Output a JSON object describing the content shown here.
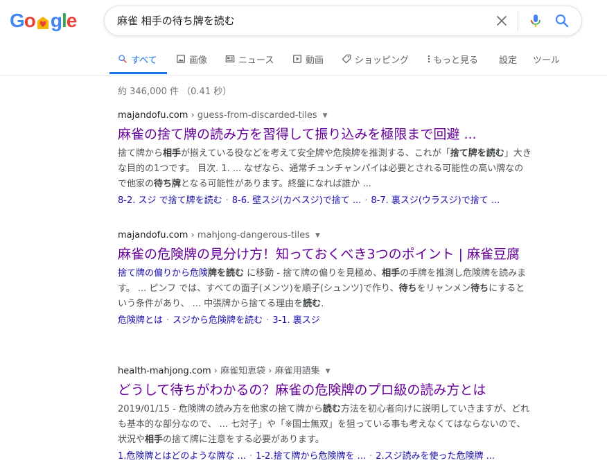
{
  "logo": {
    "letters": [
      "G",
      "o",
      "♥",
      "g",
      "l",
      "e"
    ],
    "colors": [
      "#4285f4",
      "#ea4335",
      "#f4b400",
      "#4285f4",
      "#34a853",
      "#ea4335"
    ]
  },
  "search": {
    "query": "麻雀 相手の待ち牌を読む"
  },
  "tabs": [
    {
      "label": "すべて",
      "icon": "search-icon"
    },
    {
      "label": "画像",
      "icon": "image-icon"
    },
    {
      "label": "ニュース",
      "icon": "news-icon"
    },
    {
      "label": "動画",
      "icon": "video-icon"
    },
    {
      "label": "ショッピング",
      "icon": "tag-icon"
    },
    {
      "label": "もっと見る",
      "icon": "more-vert-icon"
    },
    {
      "label": "設定"
    },
    {
      "label": "ツール"
    }
  ],
  "result_stats": "約 346,000 件 （0.41 秒）",
  "results": [
    {
      "site": "majandofu.com",
      "path": " › guess-from-discarded-tiles",
      "title": "麻雀の捨て牌の読み方を習得して振り込みを極限まで回避 ...",
      "snippet_html": "捨て牌から<b>相手</b>が揃えている役などを考えて安全牌や危険牌を推測する、これが「<b>捨て牌を読む</b>」大きな目的の1つです。 目次. 1. ... なぜなら、通常チュンチャンパイは必要とされる可能性の高い牌なので他家の<b>待ち牌</b>となる可能性があります。終盤になれば誰か ...",
      "sitelinks": [
        "8-2. スジ で捨て牌を読む",
        "8-6. 壁スジ(カベスジ)で捨て ...",
        "8-7. 裏スジ(ウラスジ)で捨て ..."
      ]
    },
    {
      "site": "majandofu.com",
      "path": " › mahjong-dangerous-tiles",
      "title": "麻雀の危険牌の見分け方！知っておくべき3つのポイント | 麻雀豆腐",
      "snippet_html": "<span class=\"hl-link\">捨て牌の偏りから危険<b>牌を読む</b></span> に移動 - 捨て牌の偏りを見極め、<b>相手</b>の手牌を推測し危険牌を読みます。 ... ピンフ では、すべての面子(メンツ)を順子(シュンツ)で作り、<b>待ち</b>をリャンメン<b>待ち</b>にするという条件があり、 ... 中張牌から捨てる理由を<b>読む</b>.",
      "sitelinks": [
        "危険牌とは",
        "スジから危険牌を読む",
        "3-1. 裏スジ"
      ]
    },
    {
      "site": "health-mahjong.com",
      "path": " › 麻雀知恵袋 › 麻雀用語集",
      "title": "どうして待ちがわかるの？麻雀の危険牌のプロ級の読み方とは",
      "snippet_html": "2019/01/15 - 危険牌の読み方を他家の捨て牌から<b>読む</b>方法を初心者向けに説明していきますが、どれも基本的な部分なので、 ... 七対子」や「※国士無双」を狙っている事も考えなくてはならないので、状況や<b>相手</b>の捨て牌に注意をする必要があります。",
      "sitelinks": [
        "1.危険牌とはどのような牌な ...",
        "1-2.捨て牌から危険牌を ...",
        "2.スジ読みを使った危険牌 ..."
      ]
    }
  ]
}
